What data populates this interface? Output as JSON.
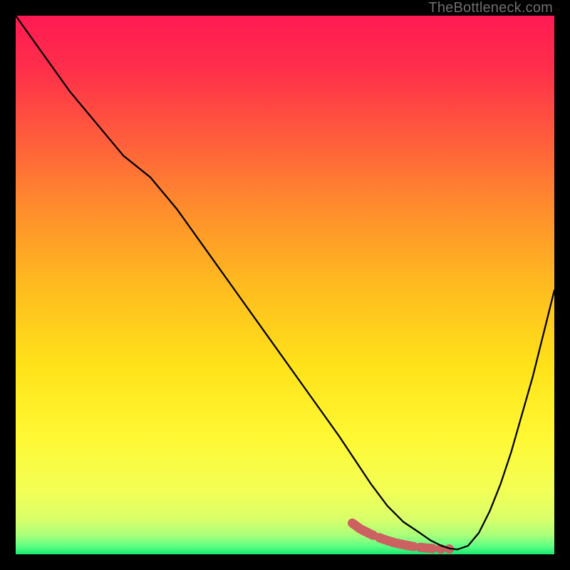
{
  "watermark": "TheBottleneck.com",
  "chart_data": {
    "type": "line",
    "title": "",
    "xlabel": "",
    "ylabel": "",
    "xlim": [
      0,
      100
    ],
    "ylim": [
      0,
      100
    ],
    "grid": false,
    "series": [
      {
        "name": "curve",
        "x": [
          0,
          5,
          10,
          15,
          20,
          25,
          30,
          35,
          40,
          45,
          50,
          55,
          60,
          63,
          66,
          69,
          72,
          75,
          77,
          79,
          80.5,
          82,
          84,
          86,
          88,
          90,
          92,
          94,
          96,
          98,
          100
        ],
        "y": [
          100,
          93,
          86,
          80,
          74,
          70,
          64,
          57,
          50,
          43,
          36,
          29,
          22,
          17.5,
          13,
          9,
          6,
          4,
          2.6,
          1.6,
          1.1,
          0.9,
          1.6,
          4,
          8,
          13,
          19,
          26,
          33,
          41,
          49
        ]
      },
      {
        "name": "marker-trail",
        "x": [
          62.5,
          64,
          66,
          68,
          69.5,
          70.5,
          72,
          73.5,
          75,
          76.5,
          77.7,
          79
        ],
        "y": [
          5.8,
          4.7,
          3.7,
          2.9,
          2.4,
          2.1,
          1.8,
          1.5,
          1.3,
          1.15,
          1.05,
          1.0
        ]
      },
      {
        "name": "marker-dot",
        "x": [
          80.5
        ],
        "y": [
          1.0
        ]
      }
    ],
    "gradient_stops": [
      {
        "offset": 0.0,
        "color": "#ff1a53"
      },
      {
        "offset": 0.1,
        "color": "#ff2f4a"
      },
      {
        "offset": 0.22,
        "color": "#ff5a3d"
      },
      {
        "offset": 0.35,
        "color": "#ff8a2e"
      },
      {
        "offset": 0.5,
        "color": "#ffbb1f"
      },
      {
        "offset": 0.65,
        "color": "#ffe21a"
      },
      {
        "offset": 0.78,
        "color": "#fff833"
      },
      {
        "offset": 0.88,
        "color": "#f3ff55"
      },
      {
        "offset": 0.935,
        "color": "#d9ff6a"
      },
      {
        "offset": 0.965,
        "color": "#a8ff7a"
      },
      {
        "offset": 0.985,
        "color": "#5dff84"
      },
      {
        "offset": 1.0,
        "color": "#18e86f"
      }
    ],
    "marker_color": "#cb6161",
    "curve_color": "#000000"
  }
}
